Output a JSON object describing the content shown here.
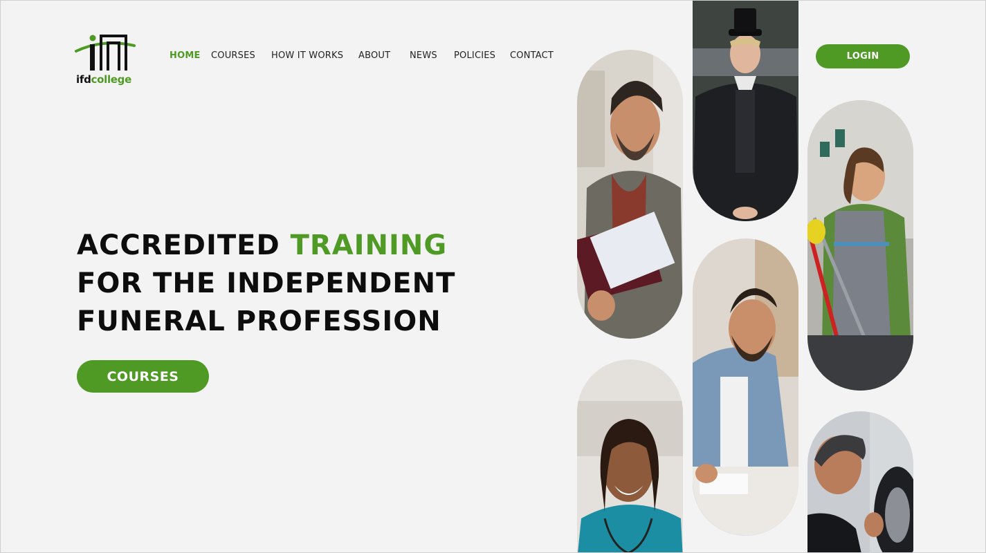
{
  "logo": {
    "text_primary": "ifd",
    "text_secondary": "college"
  },
  "nav": [
    {
      "label": "HOME",
      "active": true
    },
    {
      "label": "COURSES",
      "active": false
    },
    {
      "label": "HOW IT WORKS",
      "active": false
    },
    {
      "label": "ABOUT",
      "active": false
    },
    {
      "label": "NEWS",
      "active": false
    },
    {
      "label": "POLICIES",
      "active": false
    },
    {
      "label": "CONTACT",
      "active": false
    }
  ],
  "login_label": "LOGIN",
  "hero": {
    "line1_a": "ACCREDITED ",
    "line1_b": "TRAINING",
    "line2": "FOR THE INDEPENDENT",
    "line3": "FUNERAL PROFESSION"
  },
  "cta_label": "COURSES",
  "colors": {
    "accent": "#4f9a24",
    "background": "#f3f3f3",
    "text": "#0d0d0d"
  },
  "photos": [
    "man-with-books-photo",
    "woman-in-top-hat-photo",
    "woman-cleaning-photo",
    "man-writing-photo",
    "nurse-photo",
    "mechanic-photo"
  ]
}
